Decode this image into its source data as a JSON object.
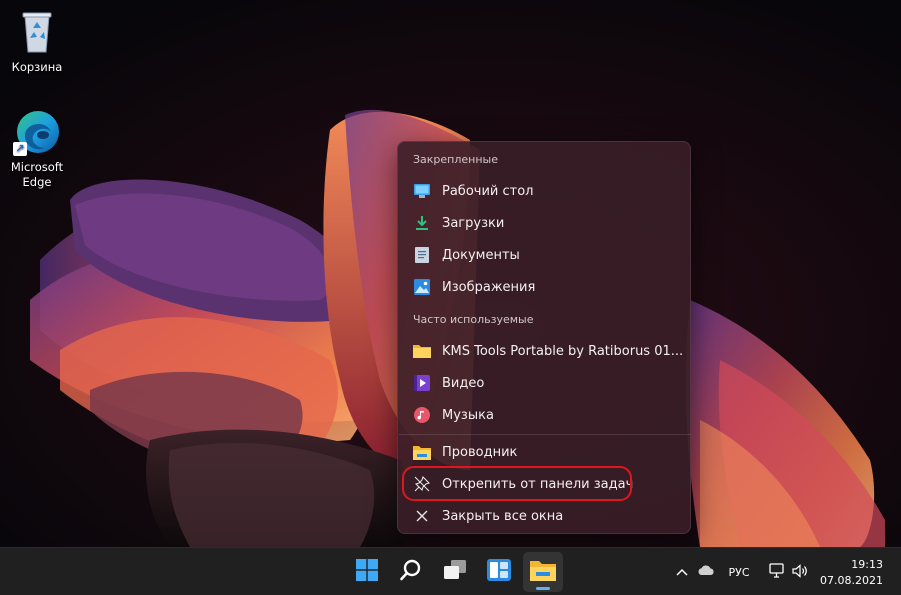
{
  "desktop": {
    "icons": [
      {
        "label": "Корзина",
        "icon": "recycle-bin-icon"
      },
      {
        "label": "Microsoft Edge",
        "icon": "edge-icon"
      }
    ]
  },
  "jumplist": {
    "pinned_header": "Закрепленные",
    "pinned": [
      {
        "label": "Рабочий стол",
        "icon": "desktop-folder-icon"
      },
      {
        "label": "Загрузки",
        "icon": "downloads-icon"
      },
      {
        "label": "Документы",
        "icon": "documents-icon"
      },
      {
        "label": "Изображения",
        "icon": "pictures-icon"
      }
    ],
    "frequent_header": "Часто используемые",
    "frequent": [
      {
        "label": "KMS Tools Portable by Ratiborus 01...",
        "icon": "folder-icon"
      },
      {
        "label": "Видео",
        "icon": "videos-icon"
      },
      {
        "label": "Музыка",
        "icon": "music-icon"
      }
    ],
    "actions": [
      {
        "label": "Проводник",
        "icon": "file-explorer-icon"
      },
      {
        "label": "Открепить от панели задач",
        "icon": "unpin-icon"
      },
      {
        "label": "Закрыть все окна",
        "icon": "close-icon"
      }
    ],
    "highlight_color": "#e0161e"
  },
  "taskbar": {
    "apps": [
      {
        "name": "start",
        "icon": "windows-start-icon"
      },
      {
        "name": "search",
        "icon": "search-icon"
      },
      {
        "name": "task-view",
        "icon": "task-view-icon"
      },
      {
        "name": "widgets",
        "icon": "widgets-icon"
      },
      {
        "name": "file-explorer",
        "icon": "file-explorer-icon",
        "active": true
      }
    ],
    "tray": {
      "language": "РУС",
      "time": "19:13",
      "date": "07.08.2021"
    },
    "background": "#202020"
  }
}
